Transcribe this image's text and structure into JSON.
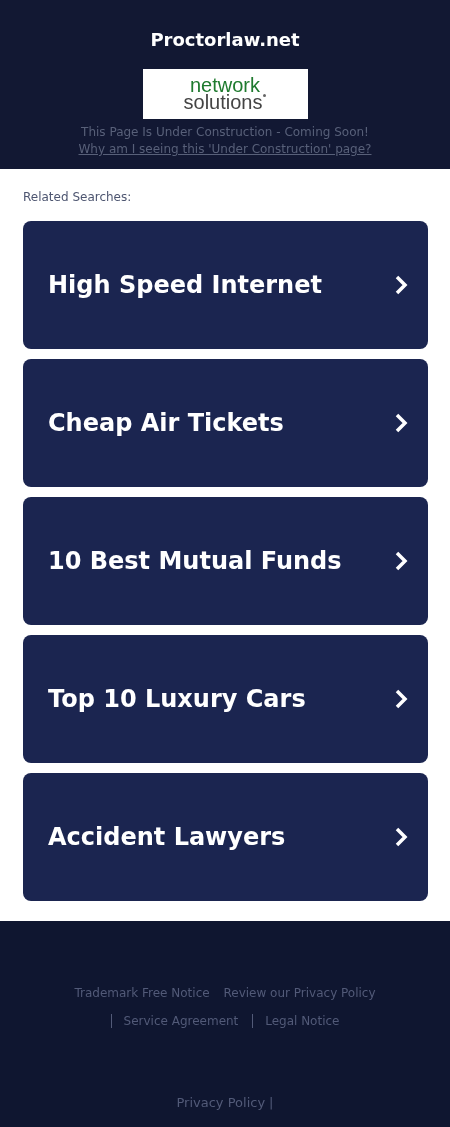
{
  "header": {
    "title": "Proctorlaw.net",
    "logo": {
      "line_1": "network",
      "line_2": "solutions"
    },
    "notice": "This Page Is Under Construction - Coming Soon!",
    "notice_link": "Why am I seeing this 'Under Construction' page?"
  },
  "related": {
    "heading": "Related Searches:",
    "items": [
      {
        "label": "High Speed Internet"
      },
      {
        "label": "Cheap Air Tickets"
      },
      {
        "label": "10 Best Mutual Funds"
      },
      {
        "label": "Top 10 Luxury Cars"
      },
      {
        "label": "Accident Lawyers"
      }
    ]
  },
  "footer": {
    "links": [
      {
        "label": "Trademark Free Notice",
        "divider": false
      },
      {
        "label": "Review our Privacy Policy",
        "divider": false
      },
      {
        "label": "Service Agreement",
        "divider": true
      },
      {
        "label": "Legal Notice",
        "divider": true
      }
    ],
    "bottom_link": "Privacy Policy",
    "bottom_separator": "|"
  }
}
